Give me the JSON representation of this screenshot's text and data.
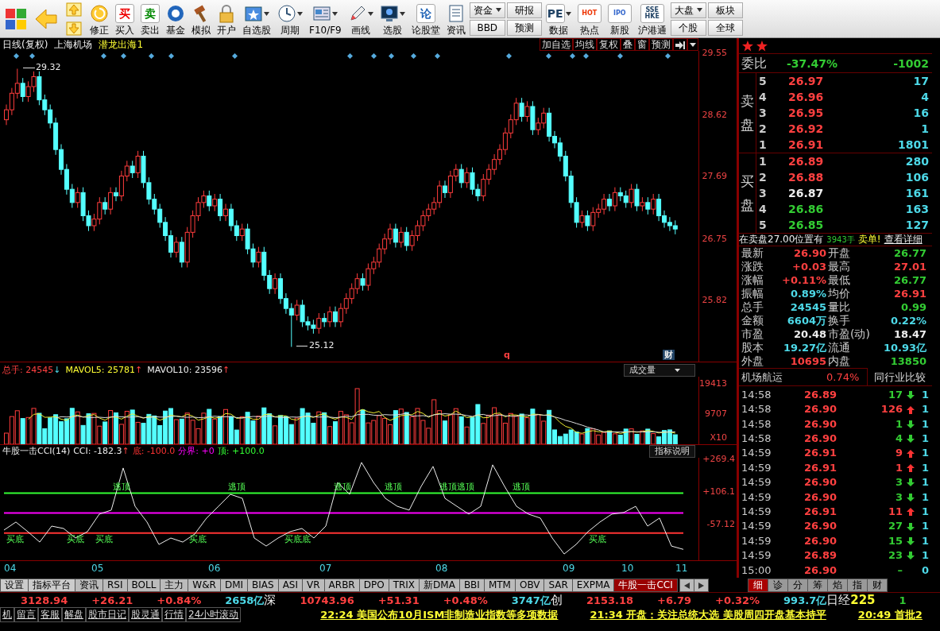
{
  "toolbar": [
    {
      "kind": "icon"
    },
    {
      "kind": "icon"
    },
    {
      "kind": "arrows"
    },
    {
      "kind": "button",
      "label": "修正",
      "dropdown": false
    },
    {
      "kind": "button",
      "glyph": "买",
      "label": "买入",
      "dropdown": false
    },
    {
      "kind": "button",
      "glyph": "卖",
      "label": "卖出",
      "dropdown": false
    },
    {
      "kind": "button",
      "label": "基金",
      "dropdown": false
    },
    {
      "kind": "button",
      "label": "模拟",
      "dropdown": false
    },
    {
      "kind": "button",
      "label": "开户",
      "dropdown": false
    },
    {
      "kind": "button",
      "label": "自选股",
      "dropdown": true
    },
    {
      "kind": "button",
      "label": "周期",
      "dropdown": true
    },
    {
      "kind": "button",
      "label": "F10/F9",
      "dropdown": true
    },
    {
      "kind": "button",
      "label": "画线",
      "dropdown": true
    },
    {
      "kind": "button",
      "label": "选股",
      "dropdown": true
    },
    {
      "kind": "button",
      "glyph": "论",
      "label": "论股堂",
      "dropdown": false
    },
    {
      "kind": "button",
      "label": "资讯",
      "dropdown": false
    },
    {
      "kind": "pair",
      "items": [
        {
          "label": "资金",
          "dropdown": true
        },
        {
          "label": "BBD",
          "dropdown": false
        }
      ]
    },
    {
      "kind": "pair",
      "items": [
        {
          "label": "研报",
          "dropdown": false
        },
        {
          "label": "预测",
          "dropdown": false
        }
      ]
    },
    {
      "kind": "button",
      "glyph": "PE",
      "label": "数据",
      "dropdown": true
    },
    {
      "kind": "button",
      "glyph": "HOT",
      "label": "热点",
      "dropdown": false
    },
    {
      "kind": "button",
      "glyph": "IPO",
      "label": "新股",
      "dropdown": false
    },
    {
      "kind": "button",
      "glyph": "SSE HKE",
      "label": "沪港通",
      "dropdown": false
    },
    {
      "kind": "pair",
      "items": [
        {
          "label": "大盘",
          "dropdown": true
        },
        {
          "label": "个股",
          "dropdown": false
        }
      ]
    },
    {
      "kind": "pair",
      "items": [
        {
          "label": "板块",
          "dropdown": false
        },
        {
          "label": "全球",
          "dropdown": false
        }
      ]
    }
  ],
  "chart": {
    "period": "日线(复权)",
    "stock": "上海机场",
    "formula": "潜龙出海1",
    "buttons": [
      "加自选",
      "均线",
      "复权",
      "叠",
      "窗",
      "预测"
    ],
    "high_label": "29.32",
    "low_label": "25.12",
    "markers": [
      "q",
      "财"
    ],
    "chart_data": {
      "type": "candlestick",
      "ylim": [
        24.91,
        29.59
      ],
      "yticks": [
        29.55,
        28.62,
        27.69,
        26.75,
        25.82
      ],
      "ohlc": [
        [
          28.55,
          28.78,
          28.47,
          28.7
        ],
        [
          28.7,
          29.03,
          28.62,
          28.95
        ],
        [
          28.95,
          29.32,
          28.87,
          29.1
        ],
        [
          29.1,
          29.18,
          28.82,
          28.9
        ],
        [
          28.9,
          29.13,
          28.82,
          29.05
        ],
        [
          29.05,
          29.28,
          28.97,
          29.2
        ],
        [
          29.2,
          29.28,
          28.77,
          28.85
        ],
        [
          28.85,
          28.93,
          28.62,
          28.7
        ],
        [
          28.7,
          28.78,
          28.42,
          28.5
        ],
        [
          28.5,
          28.58,
          28.02,
          28.1
        ],
        [
          28.1,
          28.18,
          27.72,
          27.8
        ],
        [
          27.8,
          27.88,
          27.42,
          27.5
        ],
        [
          27.5,
          27.58,
          27.22,
          27.3
        ],
        [
          27.3,
          27.53,
          27.22,
          27.45
        ],
        [
          27.45,
          27.53,
          27.02,
          27.1
        ],
        [
          27.1,
          27.18,
          26.87,
          26.95
        ],
        [
          26.95,
          27.13,
          26.87,
          27.05
        ],
        [
          27.05,
          27.38,
          26.97,
          27.3
        ],
        [
          27.3,
          27.38,
          27.12,
          27.2
        ],
        [
          27.2,
          27.53,
          27.12,
          27.45
        ],
        [
          27.45,
          27.53,
          27.32,
          27.4
        ],
        [
          27.4,
          27.78,
          27.32,
          27.7
        ],
        [
          27.7,
          27.93,
          27.62,
          27.85
        ],
        [
          27.85,
          27.93,
          27.67,
          27.75
        ],
        [
          27.75,
          28.08,
          27.67,
          28.0
        ],
        [
          28.0,
          28.08,
          27.52,
          27.6
        ],
        [
          27.6,
          27.68,
          27.27,
          27.35
        ],
        [
          27.35,
          27.43,
          27.12,
          27.2
        ],
        [
          27.2,
          27.28,
          26.92,
          27.0
        ],
        [
          27.0,
          27.08,
          26.72,
          26.8
        ],
        [
          26.8,
          26.88,
          26.47,
          26.55
        ],
        [
          26.55,
          26.78,
          26.47,
          26.7
        ],
        [
          26.7,
          26.78,
          26.32,
          26.4
        ],
        [
          26.4,
          26.93,
          26.32,
          26.85
        ],
        [
          26.85,
          27.18,
          26.77,
          27.1
        ],
        [
          27.1,
          27.38,
          27.02,
          27.3
        ],
        [
          27.3,
          27.48,
          27.22,
          27.4
        ],
        [
          27.4,
          27.48,
          27.17,
          27.25
        ],
        [
          27.25,
          27.43,
          27.17,
          27.35
        ],
        [
          27.35,
          27.43,
          27.02,
          27.1
        ],
        [
          27.1,
          27.28,
          27.02,
          27.2
        ],
        [
          27.2,
          27.28,
          26.87,
          26.95
        ],
        [
          26.95,
          27.03,
          26.72,
          26.8
        ],
        [
          26.8,
          26.98,
          26.72,
          26.9
        ],
        [
          26.9,
          26.98,
          26.52,
          26.6
        ],
        [
          26.6,
          26.68,
          26.32,
          26.4
        ],
        [
          26.4,
          26.63,
          26.32,
          26.55
        ],
        [
          26.55,
          26.63,
          26.12,
          26.2
        ],
        [
          26.2,
          26.28,
          25.92,
          26.0
        ],
        [
          26.0,
          26.23,
          25.92,
          26.15
        ],
        [
          26.15,
          26.23,
          25.77,
          25.85
        ],
        [
          25.85,
          25.93,
          25.62,
          25.7
        ],
        [
          25.7,
          25.78,
          25.12,
          25.6
        ],
        [
          25.6,
          25.83,
          25.52,
          25.75
        ],
        [
          25.75,
          25.83,
          25.42,
          25.5
        ],
        [
          25.5,
          25.58,
          25.37,
          25.45
        ],
        [
          25.45,
          25.53,
          25.32,
          25.4
        ],
        [
          25.4,
          25.63,
          25.32,
          25.55
        ],
        [
          25.55,
          25.63,
          25.42,
          25.5
        ],
        [
          25.5,
          25.73,
          25.42,
          25.65
        ],
        [
          25.65,
          25.73,
          25.42,
          25.5
        ],
        [
          25.5,
          25.78,
          25.42,
          25.7
        ],
        [
          25.7,
          25.93,
          25.62,
          25.85
        ],
        [
          25.85,
          26.08,
          25.77,
          26.0
        ],
        [
          26.0,
          26.23,
          25.92,
          26.15
        ],
        [
          26.15,
          26.23,
          25.97,
          26.05
        ],
        [
          26.05,
          26.38,
          25.97,
          26.3
        ],
        [
          26.3,
          26.48,
          26.22,
          26.4
        ],
        [
          26.4,
          26.68,
          26.32,
          26.6
        ],
        [
          26.6,
          26.83,
          26.52,
          26.75
        ],
        [
          26.75,
          26.98,
          26.67,
          26.9
        ],
        [
          26.9,
          26.98,
          26.62,
          26.7
        ],
        [
          26.7,
          26.93,
          26.62,
          26.85
        ],
        [
          26.85,
          26.93,
          26.57,
          26.65
        ],
        [
          26.65,
          26.88,
          26.57,
          26.8
        ],
        [
          26.8,
          27.03,
          26.72,
          26.95
        ],
        [
          26.95,
          27.18,
          26.87,
          27.1
        ],
        [
          27.1,
          27.28,
          27.02,
          27.2
        ],
        [
          27.2,
          27.38,
          27.12,
          27.3
        ],
        [
          27.3,
          27.63,
          27.22,
          27.55
        ],
        [
          27.55,
          27.63,
          27.37,
          27.45
        ],
        [
          27.45,
          27.78,
          27.37,
          27.7
        ],
        [
          27.7,
          27.88,
          27.62,
          27.8
        ],
        [
          27.8,
          27.88,
          27.52,
          27.6
        ],
        [
          27.6,
          27.83,
          27.52,
          27.75
        ],
        [
          27.75,
          27.83,
          27.42,
          27.5
        ],
        [
          27.5,
          27.58,
          27.32,
          27.4
        ],
        [
          27.4,
          27.73,
          27.32,
          27.65
        ],
        [
          27.65,
          27.88,
          27.57,
          27.8
        ],
        [
          27.8,
          28.03,
          27.72,
          27.95
        ],
        [
          27.95,
          28.18,
          27.87,
          28.1
        ],
        [
          28.1,
          28.43,
          28.02,
          28.35
        ],
        [
          28.35,
          28.63,
          28.27,
          28.55
        ],
        [
          28.55,
          28.88,
          28.47,
          28.8
        ],
        [
          28.8,
          28.88,
          28.52,
          28.6
        ],
        [
          28.6,
          28.83,
          28.52,
          28.75
        ],
        [
          28.75,
          28.83,
          28.32,
          28.4
        ],
        [
          28.4,
          28.58,
          28.32,
          28.5
        ],
        [
          28.5,
          28.73,
          28.42,
          28.65
        ],
        [
          28.65,
          28.73,
          28.22,
          28.3
        ],
        [
          28.3,
          28.38,
          28.12,
          28.2
        ],
        [
          28.2,
          28.28,
          27.92,
          28.0
        ],
        [
          28.0,
          28.08,
          27.62,
          27.7
        ],
        [
          27.7,
          27.78,
          27.22,
          27.3
        ],
        [
          27.3,
          27.38,
          26.92,
          27.0
        ],
        [
          27.0,
          27.18,
          26.92,
          27.1
        ],
        [
          27.1,
          27.18,
          26.87,
          26.95
        ],
        [
          26.95,
          27.23,
          26.87,
          27.15
        ],
        [
          27.15,
          27.28,
          27.07,
          27.2
        ],
        [
          27.2,
          27.43,
          27.12,
          27.35
        ],
        [
          27.35,
          27.43,
          27.17,
          27.25
        ],
        [
          27.25,
          27.53,
          27.17,
          27.45
        ],
        [
          27.45,
          27.53,
          27.32,
          27.4
        ],
        [
          27.4,
          27.48,
          27.22,
          27.3
        ],
        [
          27.3,
          27.58,
          27.22,
          27.5
        ],
        [
          27.5,
          27.58,
          27.17,
          27.25
        ],
        [
          27.25,
          27.38,
          27.17,
          27.3
        ],
        [
          27.3,
          27.38,
          27.12,
          27.2
        ],
        [
          27.2,
          27.43,
          27.12,
          27.35
        ],
        [
          27.35,
          27.43,
          27.02,
          27.1
        ],
        [
          27.1,
          27.18,
          26.92,
          27.0
        ],
        [
          27.0,
          27.08,
          26.87,
          26.95
        ],
        [
          26.95,
          27.03,
          26.82,
          26.9
        ]
      ]
    }
  },
  "volume": {
    "total": "总手: 24545",
    "total_arrow": "↓",
    "ma5": "MAVOL5: 25781",
    "ma5_arrow": "↑",
    "ma10": "MAVOL10: 23596",
    "ma10_arrow": "↑",
    "selector": "成交量",
    "axis": [
      "19413",
      "9707",
      "X10"
    ]
  },
  "cci": {
    "title": "牛股一击CCI(14)",
    "value": "CCI: -182.3",
    "arrow": "↑",
    "help_button": "指标说明",
    "chart_data": {
      "type": "line",
      "ylim": [
        -236.4,
        277.4
      ],
      "yticks": [
        {
          "value": 269.4,
          "label": "+269.4"
        },
        {
          "value": 106.1,
          "label": "+106.1"
        },
        {
          "value": -57.12,
          "label": "-57.12"
        }
      ],
      "series": [
        {
          "color": "#eeeeee",
          "values": [
            -85,
            -45,
            -93,
            -145,
            -65,
            -77,
            -125,
            -93,
            -5,
            15,
            226,
            34,
            -45,
            -157,
            -125,
            -145,
            -105,
            -25,
            34,
            94,
            74,
            -125,
            -165,
            -125,
            -93,
            -77,
            -125,
            -65,
            154,
            94,
            254,
            154,
            74,
            34,
            15,
            134,
            234,
            74,
            34,
            -5,
            34,
            242,
            134,
            34,
            -5,
            -25,
            -125,
            -205,
            -157,
            -93,
            -45,
            -5,
            3,
            34,
            -65,
            -25,
            -165,
            -182
          ]
        },
        {
          "name": "底: -100.0",
          "color": "#ff3333",
          "values": [
            -100,
            -100,
            -100,
            -100,
            -100,
            -100,
            -100,
            -100,
            -100,
            -100,
            -100,
            -100,
            -100,
            -100,
            -100,
            -100,
            -100,
            -100,
            -100,
            -100,
            -100,
            -100,
            -100,
            -100,
            -100,
            -100,
            -100,
            -100,
            -100,
            -100,
            -100,
            -100,
            -100,
            -100,
            -100,
            -100,
            -100,
            -100,
            -100,
            -100,
            -100,
            -100,
            -100,
            -100,
            -100,
            -100,
            -100,
            -100,
            -100,
            -100,
            -100,
            -100,
            -100,
            -100,
            -100,
            -100,
            -100,
            -100
          ]
        },
        {
          "name": "分界: +0",
          "color": "#ff00ff",
          "values": [
            0,
            0,
            0,
            0,
            0,
            0,
            0,
            0,
            0,
            0,
            0,
            0,
            0,
            0,
            0,
            0,
            0,
            0,
            0,
            0,
            0,
            0,
            0,
            0,
            0,
            0,
            0,
            0,
            0,
            0,
            0,
            0,
            0,
            0,
            0,
            0,
            0,
            0,
            0,
            0,
            0,
            0,
            0,
            0,
            0,
            0,
            0,
            0,
            0,
            0,
            0,
            0,
            0,
            0,
            0,
            0,
            0,
            0
          ]
        },
        {
          "name": "顶: +100.0",
          "color": "#33ff33",
          "values": [
            100,
            100,
            100,
            100,
            100,
            100,
            100,
            100,
            100,
            100,
            100,
            100,
            100,
            100,
            100,
            100,
            100,
            100,
            100,
            100,
            100,
            100,
            100,
            100,
            100,
            100,
            100,
            100,
            100,
            100,
            100,
            100,
            100,
            100,
            100,
            100,
            100,
            100,
            100,
            100,
            100,
            100,
            100,
            100,
            100,
            100,
            100,
            100,
            100,
            100,
            100,
            100,
            100,
            100,
            100,
            100,
            100,
            100
          ]
        }
      ]
    },
    "signals": [
      {
        "text": "逃顶",
        "kind": "top"
      },
      {
        "text": "逃顶",
        "kind": "top"
      },
      {
        "text": "逃顶",
        "kind": "top"
      },
      {
        "text": "逃顶",
        "kind": "top"
      },
      {
        "text": "逃顶逃顶",
        "kind": "top"
      },
      {
        "text": "逃顶",
        "kind": "top"
      },
      {
        "text": "买底",
        "kind": "bottom"
      },
      {
        "text": "买底",
        "kind": "bottom"
      },
      {
        "text": "买底",
        "kind": "bottom"
      },
      {
        "text": "买底",
        "kind": "bottom"
      },
      {
        "text": "买底底",
        "kind": "bottom"
      },
      {
        "text": "买底",
        "kind": "bottom"
      }
    ]
  },
  "dates": [
    "04",
    "05",
    "06",
    "07",
    "08",
    "09",
    "10",
    "11"
  ],
  "indicator_tabs": [
    {
      "label": "设置",
      "kind": "button",
      "selected": false
    },
    {
      "label": "指标平台",
      "kind": "button",
      "selected": false
    },
    {
      "label": "资讯",
      "kind": "tab",
      "selected": false
    },
    {
      "label": "RSI",
      "kind": "tab",
      "selected": false
    },
    {
      "label": "BOLL",
      "kind": "tab",
      "selected": false
    },
    {
      "label": "主力",
      "kind": "tab",
      "selected": false
    },
    {
      "label": "W&R",
      "kind": "tab",
      "selected": false
    },
    {
      "label": "DMI",
      "kind": "tab",
      "selected": false
    },
    {
      "label": "BIAS",
      "kind": "tab",
      "selected": false
    },
    {
      "label": "ASI",
      "kind": "tab",
      "selected": false
    },
    {
      "label": "VR",
      "kind": "tab",
      "selected": false
    },
    {
      "label": "ARBR",
      "kind": "tab",
      "selected": false
    },
    {
      "label": "DPO",
      "kind": "tab",
      "selected": false
    },
    {
      "label": "TRIX",
      "kind": "tab",
      "selected": false
    },
    {
      "label": "新DMA",
      "kind": "tab",
      "selected": false
    },
    {
      "label": "BBI",
      "kind": "tab",
      "selected": false
    },
    {
      "label": "MTM",
      "kind": "tab",
      "selected": false
    },
    {
      "label": "OBV",
      "kind": "tab",
      "selected": false
    },
    {
      "label": "SAR",
      "kind": "tab",
      "selected": false
    },
    {
      "label": "EXPMA",
      "kind": "tab",
      "selected": false
    },
    {
      "label": "牛股一击CCI",
      "kind": "tab",
      "selected": true
    }
  ],
  "quote": {
    "ratio_label": "委比",
    "ratio_pct": "-37.47%",
    "ratio_diff": "-1002",
    "sell_label": "卖盘",
    "buy_label": "买盘",
    "sell": [
      {
        "rank": "5",
        "price": "26.97",
        "volume": "17",
        "color": "#ff4040"
      },
      {
        "rank": "4",
        "price": "26.96",
        "volume": "4",
        "color": "#ff4040"
      },
      {
        "rank": "3",
        "price": "26.95",
        "volume": "16",
        "color": "#ff4040"
      },
      {
        "rank": "2",
        "price": "26.92",
        "volume": "1",
        "color": "#ff4040"
      },
      {
        "rank": "1",
        "price": "26.91",
        "volume": "1801",
        "color": "#ff4040"
      }
    ],
    "buy": [
      {
        "rank": "1",
        "price": "26.89",
        "volume": "280",
        "color": "#ff4040"
      },
      {
        "rank": "2",
        "price": "26.88",
        "volume": "106",
        "color": "#ff4040"
      },
      {
        "rank": "3",
        "price": "26.87",
        "volume": "161",
        "color": "#eeeeee"
      },
      {
        "rank": "4",
        "price": "26.86",
        "volume": "163",
        "color": "#33cc33"
      },
      {
        "rank": "5",
        "price": "26.85",
        "volume": "127",
        "color": "#33cc33"
      }
    ]
  },
  "notice": {
    "text": "在卖盘27.00位置有",
    "volume": "3943手",
    "alert": "卖单!",
    "link": "查看详细"
  },
  "stats": [
    {
      "label": "最新",
      "value": "26.90",
      "color": "#ff4040"
    },
    {
      "label": "开盘",
      "value": "26.77",
      "color": "#33cc33"
    },
    {
      "label": "涨跌",
      "value": "+0.03",
      "color": "#ff4040"
    },
    {
      "label": "最高",
      "value": "27.01",
      "color": "#ff4040"
    },
    {
      "label": "涨幅",
      "value": "+0.11%",
      "color": "#ff4040"
    },
    {
      "label": "最低",
      "value": "26.77",
      "color": "#33cc33"
    },
    {
      "label": "振幅",
      "value": "0.89%",
      "color": "#4dd9e8"
    },
    {
      "label": "均价",
      "value": "26.91",
      "color": "#ff4040"
    },
    {
      "label": "总手",
      "value": "24545",
      "color": "#4dd9e8"
    },
    {
      "label": "量比",
      "value": "0.99",
      "color": "#33cc33"
    },
    {
      "label": "金额",
      "value": "6604万",
      "color": "#4dd9e8"
    },
    {
      "label": "换手",
      "value": "0.22%",
      "color": "#4dd9e8"
    },
    {
      "label": "市盈",
      "value": "20.48",
      "color": "#eeeeee"
    },
    {
      "label": "市盈(动)",
      "value": "18.47",
      "color": "#eeeeee"
    },
    {
      "label": "股本",
      "value": "19.27亿",
      "color": "#4dd9e8"
    },
    {
      "label": "流通",
      "value": "10.93亿",
      "color": "#4dd9e8"
    },
    {
      "label": "外盘",
      "value": "10695",
      "color": "#ff4040"
    },
    {
      "label": "内盘",
      "value": "13850",
      "color": "#33cc33"
    }
  ],
  "sector": {
    "name": "机场航运",
    "change": "0.74%",
    "button": "同行业比较"
  },
  "ticks": [
    {
      "time": "14:58",
      "price": "26.89",
      "volume": "17",
      "kind": "down",
      "column_4": "1"
    },
    {
      "time": "14:58",
      "price": "26.90",
      "volume": "126",
      "kind": "up",
      "column_4": "1"
    },
    {
      "time": "14:58",
      "price": "26.90",
      "volume": "1",
      "kind": "down",
      "column_4": "1"
    },
    {
      "time": "14:58",
      "price": "26.90",
      "volume": "4",
      "kind": "down",
      "column_4": "1"
    },
    {
      "time": "14:59",
      "price": "26.91",
      "volume": "9",
      "kind": "up",
      "column_4": "1"
    },
    {
      "time": "14:59",
      "price": "26.91",
      "volume": "1",
      "kind": "up",
      "column_4": "1"
    },
    {
      "time": "14:59",
      "price": "26.90",
      "volume": "3",
      "kind": "down",
      "column_4": "1"
    },
    {
      "time": "14:59",
      "price": "26.90",
      "volume": "3",
      "kind": "down",
      "column_4": "1"
    },
    {
      "time": "14:59",
      "price": "26.91",
      "volume": "11",
      "kind": "up",
      "column_4": "1"
    },
    {
      "time": "14:59",
      "price": "26.90",
      "volume": "27",
      "kind": "down",
      "column_4": "1"
    },
    {
      "time": "14:59",
      "price": "26.90",
      "volume": "15",
      "kind": "down",
      "column_4": "1"
    },
    {
      "time": "14:59",
      "price": "26.89",
      "volume": "23",
      "kind": "down",
      "column_4": "1"
    },
    {
      "time": "15:00",
      "price": "26.90",
      "volume": "–",
      "kind": "none",
      "column_4": "0"
    }
  ],
  "side_tabs": [
    {
      "label": "细",
      "selected": true
    },
    {
      "label": "诊",
      "selected": false
    },
    {
      "label": "分",
      "selected": false
    },
    {
      "label": "筹",
      "selected": false
    },
    {
      "label": "焰",
      "selected": false
    },
    {
      "label": "指",
      "selected": false
    },
    {
      "label": "财",
      "selected": false
    }
  ],
  "index_bar": [
    {
      "text": "3128.94",
      "kind": "price"
    },
    {
      "text": "+26.21",
      "kind": "price"
    },
    {
      "text": "+0.84%",
      "kind": "price"
    },
    {
      "text": "2658亿",
      "kind": "amount"
    },
    {
      "text": "深",
      "kind": "name"
    },
    {
      "text": "10743.96",
      "kind": "price"
    },
    {
      "text": "+51.31",
      "kind": "price"
    },
    {
      "text": "+0.48%",
      "kind": "price"
    },
    {
      "text": "3747亿",
      "kind": "amount"
    },
    {
      "text": "创",
      "kind": "name"
    },
    {
      "text": "2153.18",
      "kind": "price"
    },
    {
      "text": "+6.79",
      "kind": "price"
    },
    {
      "text": "+0.32%",
      "kind": "price"
    },
    {
      "text": "993.7亿",
      "kind": "amount"
    },
    {
      "text": "日经",
      "kind": "name"
    },
    {
      "text": "225",
      "kind": "code"
    },
    {
      "text": "1",
      "kind": "fall"
    }
  ],
  "news": {
    "links": [
      "机",
      "留言",
      "客服",
      "解盘",
      "股市日记",
      "股灵通",
      "行情",
      "24小时滚动"
    ],
    "headlines": [
      "22:24 美国公布10月ISM非制造业指数等多项数据",
      "21:34 开盘：关注总统大选 美股周四开盘基本持平",
      "20:49 首批2"
    ]
  }
}
